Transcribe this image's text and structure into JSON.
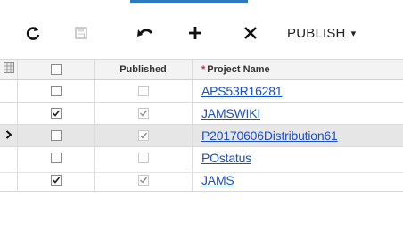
{
  "toolbar": {
    "refresh_icon": "refresh-icon",
    "save_icon": "save-icon",
    "undo_icon": "undo-icon",
    "add_icon": "add-icon",
    "delete_icon": "close-icon",
    "publish_label": "PUBLISH",
    "publish_caret": "▾"
  },
  "grid": {
    "columns": {
      "select_icon": "grid-settings-icon",
      "published": "Published",
      "project_name_required": "*",
      "project_name": "Project Name"
    },
    "rows": [
      {
        "selected": false,
        "checked": false,
        "published": false,
        "project": "APS53R16281"
      },
      {
        "selected": false,
        "checked": true,
        "published": true,
        "project": "JAMSWIKI"
      },
      {
        "selected": true,
        "checked": false,
        "published": true,
        "project": "P20170606Distribution61"
      },
      {
        "selected": false,
        "checked": false,
        "published": false,
        "project": "POstatus"
      },
      {
        "selected": false,
        "checked": true,
        "published": true,
        "project": "JAMS"
      }
    ]
  },
  "colors": {
    "link": "#1a4fc7",
    "required": "#dd2233",
    "selected_row": "#e6e6e6"
  }
}
